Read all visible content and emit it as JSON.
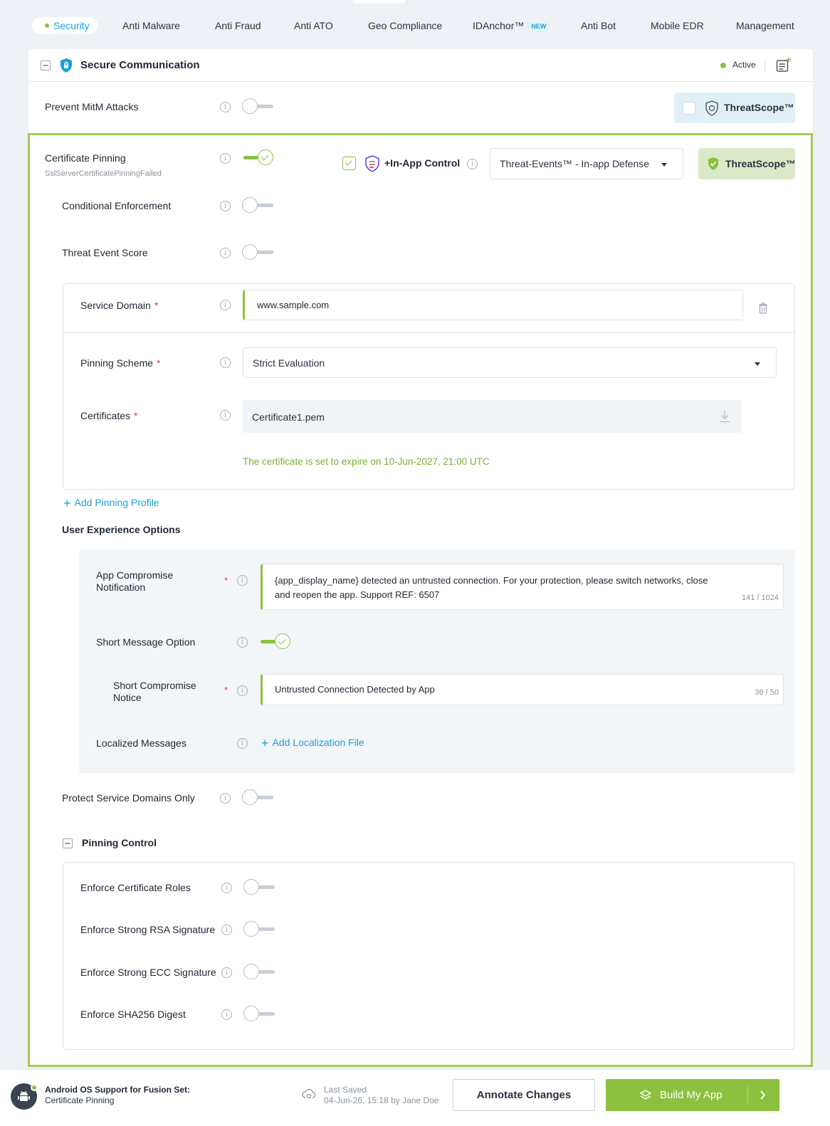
{
  "tabs": [
    {
      "label": "Security"
    },
    {
      "label": "Anti Malware"
    },
    {
      "label": "Anti Fraud"
    },
    {
      "label": "Anti ATO"
    },
    {
      "label": "Geo Compliance"
    },
    {
      "label": "IDAnchor™",
      "badge": "NEW"
    },
    {
      "label": "Anti Bot"
    },
    {
      "label": "Mobile EDR"
    },
    {
      "label": "Management"
    }
  ],
  "section": {
    "title": "Secure Communication",
    "status": "Active"
  },
  "prevent_mitm": {
    "label": "Prevent MitM Attacks",
    "enabled": false,
    "threatscope": "ThreatScope™"
  },
  "cert_pinning": {
    "label": "Certificate Pinning",
    "event_name": "SslServerCertificatePinningFailed",
    "enabled": true,
    "in_app_control": "+In-App Control",
    "in_app_checked": true,
    "defense_select": "Threat-Events™ - In-app Defense",
    "threatscope": "ThreatScope™"
  },
  "conditional_enforcement": {
    "label": "Conditional Enforcement",
    "enabled": false
  },
  "threat_event_score": {
    "label": "Threat Event Score",
    "enabled": false
  },
  "profile": {
    "service_domain_label": "Service Domain",
    "service_domain_value": "www.sample.com",
    "pinning_scheme_label": "Pinning Scheme",
    "pinning_scheme_value": "Strict Evaluation",
    "certificates_label": "Certificates",
    "certificate_file": "Certificate1.pem",
    "expiry_note": "The certificate is set to expire on 10-Jun-2027, 21:00 UTC",
    "required_mark": "*"
  },
  "add_pinning_profile": "Add Pinning Profile",
  "ux": {
    "title": "User Experience Options",
    "app_compromise_label_1": "App Compromise",
    "app_compromise_label_2": "Notification",
    "app_compromise_text_1": "{app_display_name} detected an untrusted connection. For your protection, please switch networks, close",
    "app_compromise_text_2": "and reopen the app. Support REF: 6507",
    "app_compromise_count": "141 / 1024",
    "short_message_label": "Short Message Option",
    "short_message_enabled": true,
    "short_notice_label_1": "Short Compromise",
    "short_notice_label_2": "Notice",
    "short_notice_text": "Untrusted Connection Detected by App",
    "short_notice_count": "36 / 50",
    "localized_label": "Localized Messages",
    "add_localization": "Add Localization File"
  },
  "protect_domains": {
    "label": "Protect Service Domains Only",
    "enabled": false
  },
  "pinning_control": {
    "title": "Pinning Control",
    "items": [
      {
        "label": "Enforce Certificate Roles",
        "enabled": false
      },
      {
        "label": "Enforce Strong RSA Signature",
        "enabled": false
      },
      {
        "label": "Enforce Strong ECC Signature",
        "enabled": false
      },
      {
        "label": "Enforce SHA256 Digest",
        "enabled": false
      }
    ]
  },
  "footer": {
    "platform_title": "Android OS Support for Fusion Set:",
    "platform_sub": "Certificate Pinning",
    "last_saved_label": "Last Saved",
    "last_saved_value": "04-Jun-26, 15:18 by Jane Doe",
    "annotate_button": "Annotate Changes",
    "build_button": "Build My App"
  },
  "colors": {
    "accent_blue": "#1ba0d8",
    "accent_green": "#8cc13f",
    "required_red": "#e0373f"
  }
}
